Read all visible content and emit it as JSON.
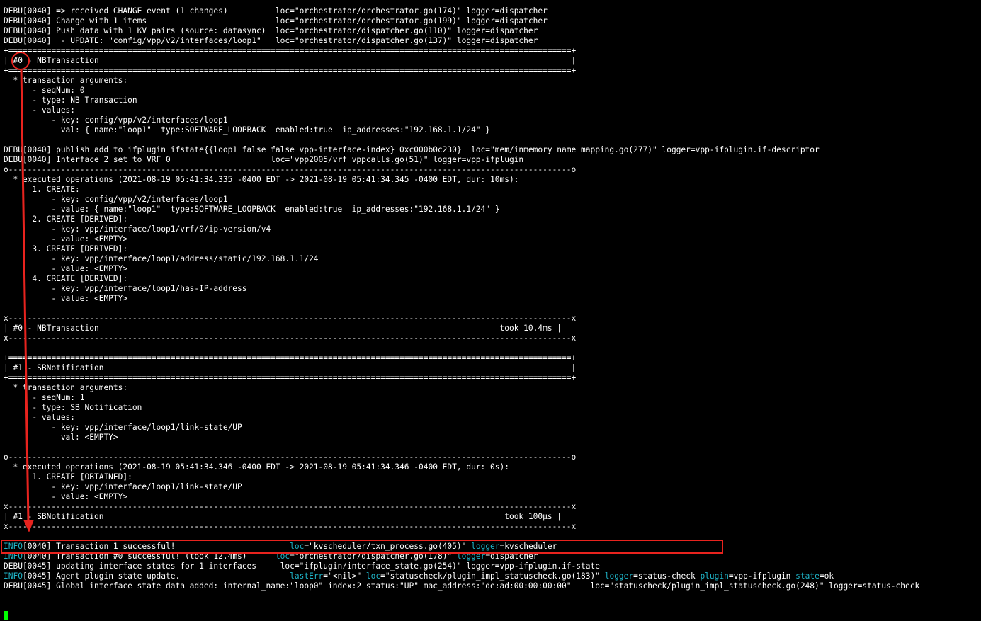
{
  "terminal": {
    "lines": [
      {
        "row": 0,
        "segments": [
          {
            "t": "DEBU[0040] => received CHANGE event (1 changes)          loc=\"orchestrator/orchestrator.go(174)\" logger=dispatcher"
          }
        ]
      },
      {
        "row": 1,
        "segments": [
          {
            "t": "DEBU[0040] Change with 1 items                           loc=\"orchestrator/orchestrator.go(199)\" logger=dispatcher"
          }
        ]
      },
      {
        "row": 2,
        "segments": [
          {
            "t": "DEBU[0040] Push data with 1 KV pairs (source: datasync)  loc=\"orchestrator/dispatcher.go(110)\" logger=dispatcher"
          }
        ]
      },
      {
        "row": 3,
        "segments": [
          {
            "t": "DEBU[0040]  - UPDATE: \"config/vpp/v2/interfaces/loop1\"   loc=\"orchestrator/dispatcher.go(137)\" logger=dispatcher"
          }
        ]
      },
      {
        "row": 4,
        "segments": [
          {
            "t": "+======================================================================================================================+"
          }
        ]
      },
      {
        "row": 5,
        "segments": [
          {
            "t": "| #0 - NBTransaction                                                                                                   |"
          }
        ]
      },
      {
        "row": 6,
        "segments": [
          {
            "t": "+======================================================================================================================+"
          }
        ]
      },
      {
        "row": 7,
        "segments": [
          {
            "t": "  * transaction arguments:"
          }
        ]
      },
      {
        "row": 8,
        "segments": [
          {
            "t": "      - seqNum: 0"
          }
        ]
      },
      {
        "row": 9,
        "segments": [
          {
            "t": "      - type: NB Transaction"
          }
        ]
      },
      {
        "row": 10,
        "segments": [
          {
            "t": "      - values:"
          }
        ]
      },
      {
        "row": 11,
        "segments": [
          {
            "t": "          - key: config/vpp/v2/interfaces/loop1"
          }
        ]
      },
      {
        "row": 12,
        "segments": [
          {
            "t": "            val: { name:\"loop1\"  type:SOFTWARE_LOOPBACK  enabled:true  ip_addresses:\"192.168.1.1/24\" }"
          }
        ]
      },
      {
        "row": 14,
        "segments": [
          {
            "t": "DEBU[0040] publish add to ifplugin_ifstate{{loop1 false false vpp-interface-index} 0xc000b0c230}  loc=\"mem/inmemory_name_mapping.go(277)\" logger=vpp-ifplugin.if-descriptor"
          }
        ]
      },
      {
        "row": 15,
        "segments": [
          {
            "t": "DEBU[0040] Interface 2 set to VRF 0                     loc=\"vpp2005/vrf_vppcalls.go(51)\" logger=vpp-ifplugin"
          }
        ]
      },
      {
        "row": 16,
        "segments": [
          {
            "t": "o----------------------------------------------------------------------------------------------------------------------o"
          }
        ]
      },
      {
        "row": 17,
        "segments": [
          {
            "t": "  * executed operations (2021-08-19 05:41:34.335 -0400 EDT -> 2021-08-19 05:41:34.345 -0400 EDT, dur: 10ms):"
          }
        ]
      },
      {
        "row": 18,
        "segments": [
          {
            "t": "      1. CREATE:"
          }
        ]
      },
      {
        "row": 19,
        "segments": [
          {
            "t": "          - key: config/vpp/v2/interfaces/loop1"
          }
        ]
      },
      {
        "row": 20,
        "segments": [
          {
            "t": "          - value: { name:\"loop1\"  type:SOFTWARE_LOOPBACK  enabled:true  ip_addresses:\"192.168.1.1/24\" }"
          }
        ]
      },
      {
        "row": 21,
        "segments": [
          {
            "t": "      2. CREATE [DERIVED]:"
          }
        ]
      },
      {
        "row": 22,
        "segments": [
          {
            "t": "          - key: vpp/interface/loop1/vrf/0/ip-version/v4"
          }
        ]
      },
      {
        "row": 23,
        "segments": [
          {
            "t": "          - value: <EMPTY>"
          }
        ]
      },
      {
        "row": 24,
        "segments": [
          {
            "t": "      3. CREATE [DERIVED]:"
          }
        ]
      },
      {
        "row": 25,
        "segments": [
          {
            "t": "          - key: vpp/interface/loop1/address/static/192.168.1.1/24"
          }
        ]
      },
      {
        "row": 26,
        "segments": [
          {
            "t": "          - value: <EMPTY>"
          }
        ]
      },
      {
        "row": 27,
        "segments": [
          {
            "t": "      4. CREATE [DERIVED]:"
          }
        ]
      },
      {
        "row": 28,
        "segments": [
          {
            "t": "          - key: vpp/interface/loop1/has-IP-address"
          }
        ]
      },
      {
        "row": 29,
        "segments": [
          {
            "t": "          - value: <EMPTY>"
          }
        ]
      },
      {
        "row": 31,
        "segments": [
          {
            "t": "x----------------------------------------------------------------------------------------------------------------------x"
          }
        ]
      },
      {
        "row": 32,
        "segments": [
          {
            "t": "| #0 - NBTransaction                                                                                    took 10.4ms |"
          }
        ]
      },
      {
        "row": 33,
        "segments": [
          {
            "t": "x----------------------------------------------------------------------------------------------------------------------x"
          }
        ]
      },
      {
        "row": 35,
        "segments": [
          {
            "t": "+======================================================================================================================+"
          }
        ]
      },
      {
        "row": 36,
        "segments": [
          {
            "t": "| #1 - SBNotification                                                                                                  |"
          }
        ]
      },
      {
        "row": 37,
        "segments": [
          {
            "t": "+======================================================================================================================+"
          }
        ]
      },
      {
        "row": 38,
        "segments": [
          {
            "t": "  * transaction arguments:"
          }
        ]
      },
      {
        "row": 39,
        "segments": [
          {
            "t": "      - seqNum: 1"
          }
        ]
      },
      {
        "row": 40,
        "segments": [
          {
            "t": "      - type: SB Notification"
          }
        ]
      },
      {
        "row": 41,
        "segments": [
          {
            "t": "      - values:"
          }
        ]
      },
      {
        "row": 42,
        "segments": [
          {
            "t": "          - key: vpp/interface/loop1/link-state/UP"
          }
        ]
      },
      {
        "row": 43,
        "segments": [
          {
            "t": "            val: <EMPTY>"
          }
        ]
      },
      {
        "row": 45,
        "segments": [
          {
            "t": "o----------------------------------------------------------------------------------------------------------------------o"
          }
        ]
      },
      {
        "row": 46,
        "segments": [
          {
            "t": "  * executed operations (2021-08-19 05:41:34.346 -0400 EDT -> 2021-08-19 05:41:34.346 -0400 EDT, dur: 0s):"
          }
        ]
      },
      {
        "row": 47,
        "segments": [
          {
            "t": "      1. CREATE [OBTAINED]:"
          }
        ]
      },
      {
        "row": 48,
        "segments": [
          {
            "t": "          - key: vpp/interface/loop1/link-state/UP"
          }
        ]
      },
      {
        "row": 49,
        "segments": [
          {
            "t": "          - value: <EMPTY>"
          }
        ]
      },
      {
        "row": 50,
        "segments": [
          {
            "t": "x----------------------------------------------------------------------------------------------------------------------x"
          }
        ]
      },
      {
        "row": 51,
        "segments": [
          {
            "t": "| #1 - SBNotification                                                                                    took 100µs |"
          }
        ]
      },
      {
        "row": 52,
        "segments": [
          {
            "t": "x----------------------------------------------------------------------------------------------------------------------x"
          }
        ]
      },
      {
        "row": 54,
        "segments": [
          {
            "t": "INFO",
            "c": "info"
          },
          {
            "t": "[0040] Transaction 1 successful!                        "
          },
          {
            "t": "loc",
            "c": "key"
          },
          {
            "t": "=\"kvscheduler/txn_process.go(405)\" "
          },
          {
            "t": "logger",
            "c": "key"
          },
          {
            "t": "=kvscheduler"
          }
        ]
      },
      {
        "row": 55,
        "segments": [
          {
            "t": "INFO",
            "c": "info"
          },
          {
            "t": "[0040] Transaction #0 successful! (took 12.4ms)      "
          },
          {
            "t": "loc",
            "c": "key"
          },
          {
            "t": "=\"orchestrator/dispatcher.go(178)\" "
          },
          {
            "t": "logger",
            "c": "key"
          },
          {
            "t": "=dispatcher"
          }
        ]
      },
      {
        "row": 56,
        "segments": [
          {
            "t": "DEBU[0045] updating interface states for 1 interfaces     loc=\"ifplugin/interface_state.go(254)\" logger=vpp-ifplugin.if-state"
          }
        ]
      },
      {
        "row": 57,
        "segments": [
          {
            "t": "INFO",
            "c": "info"
          },
          {
            "t": "[0045] Agent plugin state update.                       "
          },
          {
            "t": "lastErr",
            "c": "key"
          },
          {
            "t": "=\"<nil>\" "
          },
          {
            "t": "loc",
            "c": "key"
          },
          {
            "t": "=\"statuscheck/plugin_impl_statuscheck.go(183)\" "
          },
          {
            "t": "logger",
            "c": "key"
          },
          {
            "t": "=status-check "
          },
          {
            "t": "plugin",
            "c": "key"
          },
          {
            "t": "=vpp-ifplugin "
          },
          {
            "t": "state",
            "c": "key"
          },
          {
            "t": "=ok"
          }
        ]
      },
      {
        "row": 58,
        "segments": [
          {
            "t": "DEBU[0045] Global interface state data added: internal_name:\"loop0\" index:2 status:\"UP\" mac_address:\"de:ad:00:00:00:00\"    loc=\"statuscheck/plugin_impl_statuscheck.go(248)\" logger=status-check"
          }
        ]
      }
    ]
  },
  "colors": {
    "background": "#000000",
    "text": "#ffffff",
    "level_info": "#1fb5c9",
    "field_key": "#1fb5c9",
    "annotation": "#e8231e",
    "cursor": "#00ff00"
  },
  "annotations": {
    "circle_target": "#0",
    "highlighted_line": "Transaction #0 successful! (took 12.4ms)"
  }
}
